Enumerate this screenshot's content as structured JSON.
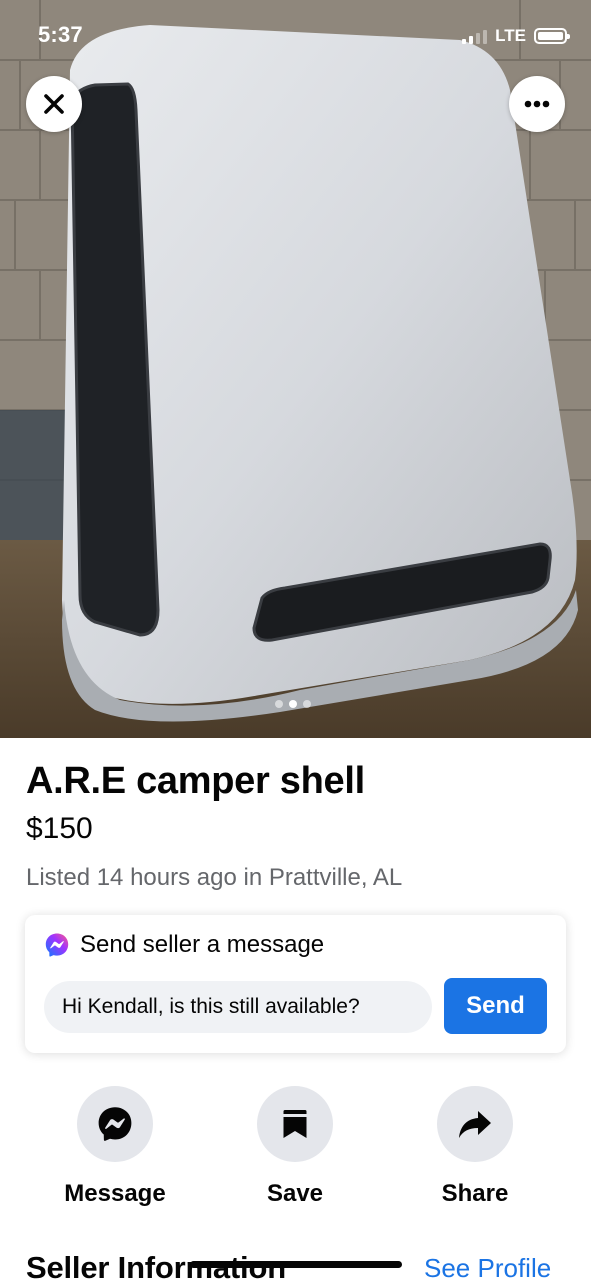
{
  "status_bar": {
    "time": "5:37",
    "network": "LTE",
    "signal_bars": 2,
    "battery_level": 1.0
  },
  "photo": {
    "description_icon": "camper-shell-photo",
    "pager": {
      "count": 3,
      "active_index": 1
    }
  },
  "listing": {
    "title": "A.R.E camper shell",
    "price": "$150",
    "meta": "Listed 14 hours ago in Prattville, AL"
  },
  "message_card": {
    "title": "Send seller a message",
    "input_value": "Hi Kendall, is this still available?",
    "send_label": "Send",
    "icon": "messenger-icon"
  },
  "actions": [
    {
      "label": "Message",
      "icon": "messenger-icon"
    },
    {
      "label": "Save",
      "icon": "bookmark-icon"
    },
    {
      "label": "Share",
      "icon": "share-arrow-icon"
    }
  ],
  "seller": {
    "heading": "Seller Information",
    "see_profile_label": "See Profile"
  },
  "colors": {
    "accent": "#1b74e4",
    "text_primary": "#050505",
    "text_secondary": "#65676b",
    "button_gray": "#e4e6eb",
    "input_bg": "#f0f2f5"
  }
}
